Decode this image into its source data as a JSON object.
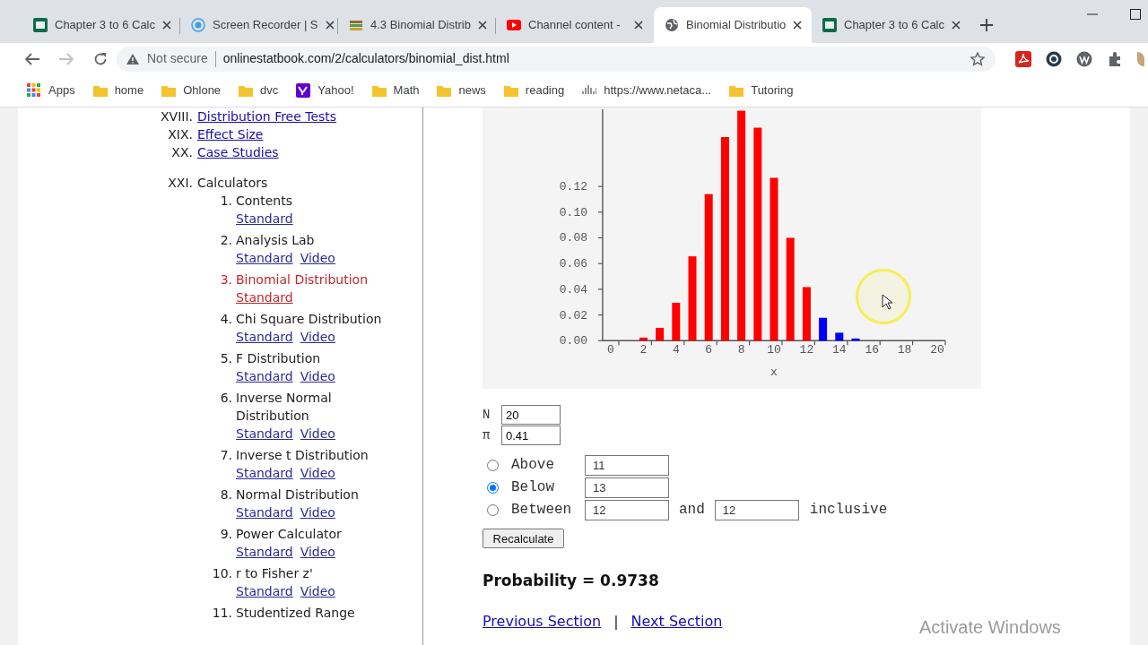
{
  "browser": {
    "tabs": [
      {
        "title": "Chapter 3 to 6 Calc",
        "kind": "dvc",
        "selected": false
      },
      {
        "title": "Screen Recorder | S",
        "kind": "recorder",
        "selected": false
      },
      {
        "title": "4.3 Binomial Distrib",
        "kind": "book",
        "selected": false
      },
      {
        "title": "Channel content -",
        "kind": "video",
        "selected": false
      },
      {
        "title": "Binomial Distributio",
        "kind": "globe",
        "selected": true
      },
      {
        "title": "Chapter 3 to 6 Calc",
        "kind": "dvc",
        "selected": false
      }
    ],
    "security": "Not secure",
    "url": "onlinestatbook.com/2/calculators/binomial_dist.html",
    "bookmarks": [
      {
        "label": "Apps",
        "kind": "apps"
      },
      {
        "label": "home",
        "kind": "folder"
      },
      {
        "label": "Ohlone",
        "kind": "folder"
      },
      {
        "label": "dvc",
        "kind": "folder"
      },
      {
        "label": "Yahoo!",
        "kind": "yahoo"
      },
      {
        "label": "Math",
        "kind": "folder"
      },
      {
        "label": "news",
        "kind": "folder"
      },
      {
        "label": "reading",
        "kind": "folder"
      },
      {
        "label": "https://www.netaca...",
        "kind": "cisco"
      },
      {
        "label": "Tutoring",
        "kind": "folder"
      }
    ]
  },
  "sidebar": {
    "sections": [
      {
        "numeral": "XVIII.",
        "title": "Distribution Free Tests",
        "kind": "link"
      },
      {
        "numeral": "XIX.",
        "title": "Effect Size",
        "kind": "link"
      },
      {
        "numeral": "XX.",
        "title": "Case Studies",
        "kind": "link"
      },
      {
        "numeral": "XXI.",
        "title": "Calculators",
        "kind": "heading",
        "children": [
          {
            "number": "1.",
            "title": "Contents",
            "selected": false,
            "links": [
              "Standard"
            ]
          },
          {
            "number": "2.",
            "title": "Analysis Lab",
            "selected": false,
            "links": [
              "Standard",
              "Video"
            ]
          },
          {
            "number": "3.",
            "title": "Binomial Distribution",
            "selected": true,
            "links": [
              "Standard"
            ]
          },
          {
            "number": "4.",
            "title": "Chi Square Distribution",
            "selected": false,
            "links": [
              "Standard",
              "Video"
            ]
          },
          {
            "number": "5.",
            "title": "F Distribution",
            "selected": false,
            "links": [
              "Standard",
              "Video"
            ]
          },
          {
            "number": "6.",
            "title": "Inverse Normal Distribution",
            "selected": false,
            "links": [
              "Standard",
              "Video"
            ]
          },
          {
            "number": "7.",
            "title": "Inverse t Distribution",
            "selected": false,
            "links": [
              "Standard",
              "Video"
            ]
          },
          {
            "number": "8.",
            "title": "Normal Distribution",
            "selected": false,
            "links": [
              "Standard",
              "Video"
            ]
          },
          {
            "number": "9.",
            "title": "Power Calculator",
            "selected": false,
            "links": [
              "Standard",
              "Video"
            ]
          },
          {
            "number": "10.",
            "title": "r to Fisher z'",
            "selected": false,
            "links": [
              "Standard",
              "Video"
            ]
          },
          {
            "number": "11.",
            "title": "Studentized Range",
            "selected": false
          }
        ]
      }
    ]
  },
  "calculator": {
    "chart_data": {
      "type": "bar",
      "xlabel": "x",
      "x": [
        2,
        3,
        4,
        5,
        6,
        7,
        8,
        9,
        10,
        11,
        12,
        13,
        14,
        15
      ],
      "xlim": [
        -0.5,
        20.5
      ],
      "ylim": [
        0,
        0.18
      ],
      "xticks": [
        0,
        2,
        4,
        6,
        8,
        10,
        12,
        14,
        16,
        18,
        20
      ],
      "yticks": [
        {
          "value": 0,
          "label": "0.00"
        },
        {
          "value": 0.02,
          "label": "0.02"
        },
        {
          "value": 0.04,
          "label": "0.04"
        },
        {
          "value": 0.06,
          "label": "0.06"
        },
        {
          "value": 0.08,
          "label": "0.08"
        },
        {
          "value": 0.1,
          "label": "0.10"
        },
        {
          "value": 0.12,
          "label": "0.12"
        }
      ],
      "series": [
        {
          "color": "#ff0000",
          "values": [
            0.0024,
            0.01,
            0.0295,
            0.0656,
            0.114,
            0.1584,
            0.1789,
            0.1657,
            0.1267,
            0.08,
            0.0417,
            null,
            null,
            null
          ]
        },
        {
          "color": "#0000ff",
          "values": [
            null,
            null,
            null,
            null,
            null,
            null,
            null,
            null,
            null,
            null,
            null,
            0.0178,
            0.0062,
            0.0017
          ]
        }
      ]
    },
    "params": [
      {
        "label": "N",
        "value": "20"
      },
      {
        "label": "π",
        "value": "0.41"
      }
    ],
    "options": [
      {
        "label": "Above",
        "selected": false,
        "values": [
          "11"
        ]
      },
      {
        "label": "Below",
        "selected": true,
        "values": [
          "13"
        ]
      },
      {
        "label": "Between",
        "selected": false,
        "values": [
          "12",
          "12"
        ],
        "connector": "and",
        "suffix": "inclusive"
      }
    ],
    "button": "Recalculate",
    "result": "Probability = 0.9738",
    "nav": [
      {
        "label": "Previous Section"
      },
      {
        "label": "Next Section"
      }
    ],
    "nav_separator": "|"
  },
  "os_notice": "Activate Windows"
}
